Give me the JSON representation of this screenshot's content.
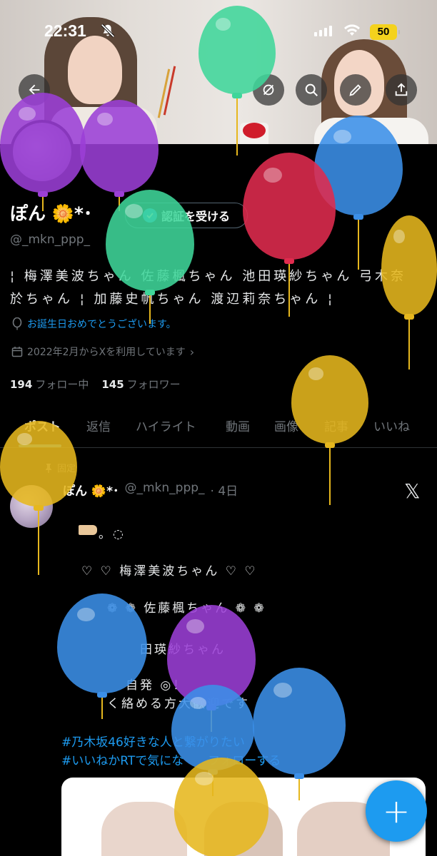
{
  "status_bar": {
    "time": "22:31",
    "battery": "50",
    "icons": [
      "bell-slash-icon",
      "signal-icon",
      "wifi-icon",
      "battery-icon"
    ]
  },
  "header": {
    "buttons": [
      "back-arrow-icon",
      "hide-icon",
      "search-icon",
      "edit-icon",
      "share-icon"
    ]
  },
  "profile": {
    "name": "ぽん 🌼*･",
    "verify_button": "認証を受ける",
    "handle": "@_mkn_ppp_",
    "bio_line1": "¦ 梅澤美波ちゃん 佐藤楓ちゃん 池田瑛紗ちゃん 弓木奈",
    "bio_line2": "於ちゃん ¦ 加藤史帆ちゃん 渡辺莉奈ちゃん ¦",
    "birthday": "お誕生日おめでとうございます。",
    "joined": "2022年2月からXを利用しています",
    "following_count": "194",
    "following_label": "フォロー中",
    "followers_count": "145",
    "followers_label": "フォロワー"
  },
  "tabs": [
    {
      "label": "ポスト",
      "active": true
    },
    {
      "label": "返信",
      "active": false
    },
    {
      "label": "ハイライト",
      "active": false
    },
    {
      "label": "動画",
      "active": false
    },
    {
      "label": "画像",
      "active": false
    },
    {
      "label": "記事",
      "active": false
    },
    {
      "label": "いいね",
      "active": false
    }
  ],
  "pinned_tweet": {
    "pinned_label": "固定",
    "author_name": "ぽん 🌼*･",
    "author_handle": "@_mkn_ppp_",
    "time": "· 4日",
    "lines": [
      "。◌",
      "♡ ♡ 梅澤美波ちゃん ♡ ♡",
      "❁ ❁ 佐藤楓ちゃん ❁ ❁",
      "田瑛紗ちゃん",
      "自発 ◎！",
      "く絡める方大歓迎です"
    ],
    "hashtags": [
      "#乃木坂46好きな人と繋がりたい",
      "#いいねかRTで気にな　　フォローする"
    ]
  },
  "fab": {
    "label": "+"
  },
  "colors": {
    "accent": "#1d9bf0",
    "background": "#000000",
    "text_primary": "#e7e9ea",
    "text_secondary": "#71767b",
    "battery": "#f4d21d"
  },
  "overlay": {
    "balloon_colors": [
      "#3fd69a",
      "#9b3fd6",
      "#3b8fe8",
      "#e02b4e",
      "#e6b71e"
    ]
  }
}
